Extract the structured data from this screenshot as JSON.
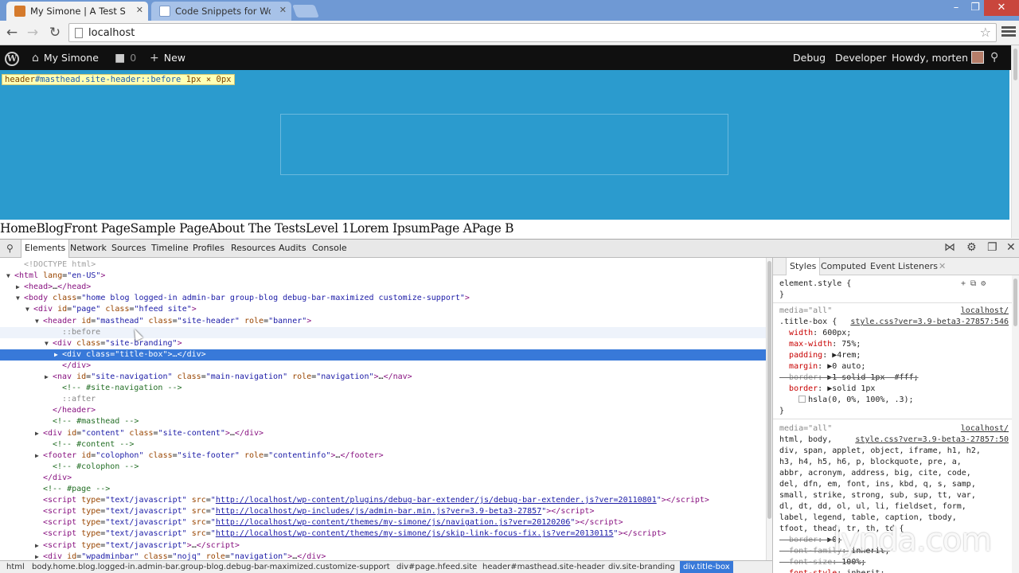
{
  "browser": {
    "tabs": [
      {
        "title": "My Simone | A Test Site fo",
        "active": true
      },
      {
        "title": "Code Snippets for WordPr",
        "active": false
      }
    ],
    "url": "localhost"
  },
  "admin_bar": {
    "site_name": "My Simone",
    "comments_count": "0",
    "new_label": "New",
    "debug_label": "Debug",
    "developer_label": "Developer",
    "howdy_label": "Howdy, morten"
  },
  "site": {
    "inspect_tooltip": {
      "tag": "header",
      "selector": "#masthead.site-header::before",
      "size": "1px × 0px"
    },
    "nav_items": [
      "Home",
      "Blog",
      "Front Page",
      "Sample Page",
      "About The Tests",
      "Level 1",
      "Lorem Ipsum",
      "Page A",
      "Page B"
    ]
  },
  "devtools": {
    "tabs": [
      "Elements",
      "Network",
      "Sources",
      "Timeline",
      "Profiles",
      "Resources",
      "Audits",
      "Console"
    ],
    "active_tab": "Elements",
    "dom_lines": [
      {
        "indent": 1,
        "tri": "",
        "cls": "dc",
        "text": "<!DOCTYPE html>"
      },
      {
        "indent": 0,
        "tri": "▼",
        "html": "<span class=\"tg\">&lt;html</span> <span class=\"an\">lang</span>=<span class=\"av\">\"en-US\"</span><span class=\"tg\">&gt;</span>"
      },
      {
        "indent": 1,
        "tri": "▶",
        "html": "<span class=\"tg\">&lt;head&gt;</span>…<span class=\"tg\">&lt;/head&gt;</span>"
      },
      {
        "indent": 1,
        "tri": "▼",
        "html": "<span class=\"tg\">&lt;body</span> <span class=\"an\">class</span>=<span class=\"av\">\"home blog logged-in admin-bar group-blog debug-bar-maximized customize-support\"</span><span class=\"tg\">&gt;</span>"
      },
      {
        "indent": 2,
        "tri": "▼",
        "html": "<span class=\"tg\">&lt;div</span> <span class=\"an\">id</span>=<span class=\"av\">\"page\"</span> <span class=\"an\">class</span>=<span class=\"av\">\"hfeed site\"</span><span class=\"tg\">&gt;</span>"
      },
      {
        "indent": 3,
        "tri": "▼",
        "html": "<span class=\"tg\">&lt;header</span> <span class=\"an\">id</span>=<span class=\"av\">\"masthead\"</span> <span class=\"an\">class</span>=<span class=\"av\">\"site-header\"</span> <span class=\"an\">role</span>=<span class=\"av\">\"banner\"</span><span class=\"tg\">&gt;</span>"
      },
      {
        "indent": 5,
        "tri": "",
        "hov": true,
        "html": "<span class=\"ps\">::before</span>"
      },
      {
        "indent": 4,
        "tri": "▼",
        "html": "<span class=\"tg\">&lt;div</span> <span class=\"an\">class</span>=<span class=\"av\">\"site-branding\"</span><span class=\"tg\">&gt;</span>"
      },
      {
        "indent": 5,
        "tri": "▶",
        "sel": true,
        "html": "<span class=\"tg\">&lt;div</span> <span class=\"an\">class</span>=<span class=\"av\">\"title-box\"</span><span class=\"tg\">&gt;</span>…<span class=\"tg\">&lt;/div&gt;</span>"
      },
      {
        "indent": 5,
        "tri": "",
        "html": "<span class=\"tg\">&lt;/div&gt;</span>"
      },
      {
        "indent": 4,
        "tri": "▶",
        "html": "<span class=\"tg\">&lt;nav</span> <span class=\"an\">id</span>=<span class=\"av\">\"site-navigation\"</span> <span class=\"an\">class</span>=<span class=\"av\">\"main-navigation\"</span> <span class=\"an\">role</span>=<span class=\"av\">\"navigation\"</span><span class=\"tg\">&gt;</span>…<span class=\"tg\">&lt;/nav&gt;</span>"
      },
      {
        "indent": 5,
        "tri": "",
        "html": "<span class=\"cm\">&lt;!-- #site-navigation --&gt;</span>"
      },
      {
        "indent": 5,
        "tri": "",
        "html": "<span class=\"ps\">::after</span>"
      },
      {
        "indent": 4,
        "tri": "",
        "html": "<span class=\"tg\">&lt;/header&gt;</span>"
      },
      {
        "indent": 4,
        "tri": "",
        "html": "<span class=\"cm\">&lt;!-- #masthead --&gt;</span>"
      },
      {
        "indent": 3,
        "tri": "▶",
        "html": "<span class=\"tg\">&lt;div</span> <span class=\"an\">id</span>=<span class=\"av\">\"content\"</span> <span class=\"an\">class</span>=<span class=\"av\">\"site-content\"</span><span class=\"tg\">&gt;</span>…<span class=\"tg\">&lt;/div&gt;</span>"
      },
      {
        "indent": 4,
        "tri": "",
        "html": "<span class=\"cm\">&lt;!-- #content --&gt;</span>"
      },
      {
        "indent": 3,
        "tri": "▶",
        "html": "<span class=\"tg\">&lt;footer</span> <span class=\"an\">id</span>=<span class=\"av\">\"colophon\"</span> <span class=\"an\">class</span>=<span class=\"av\">\"site-footer\"</span> <span class=\"an\">role</span>=<span class=\"av\">\"contentinfo\"</span><span class=\"tg\">&gt;</span>…<span class=\"tg\">&lt;/footer&gt;</span>"
      },
      {
        "indent": 4,
        "tri": "",
        "html": "<span class=\"cm\">&lt;!-- #colophon --&gt;</span>"
      },
      {
        "indent": 3,
        "tri": "",
        "html": "<span class=\"tg\">&lt;/div&gt;</span>"
      },
      {
        "indent": 3,
        "tri": "",
        "html": "<span class=\"cm\">&lt;!-- #page --&gt;</span>"
      },
      {
        "indent": 3,
        "tri": "",
        "html": "<span class=\"tg\">&lt;script</span> <span class=\"an\">type</span>=<span class=\"av\">\"text/javascript\"</span> <span class=\"an\">src</span>=<span class=\"av\">\"</span><span class=\"lk\">http://localhost/wp-content/plugins/debug-bar-extender/js/debug-bar-extender.js?ver=20110801</span><span class=\"av\">\"</span><span class=\"tg\">&gt;&lt;/script&gt;</span>"
      },
      {
        "indent": 3,
        "tri": "",
        "html": "<span class=\"tg\">&lt;script</span> <span class=\"an\">type</span>=<span class=\"av\">\"text/javascript\"</span> <span class=\"an\">src</span>=<span class=\"av\">\"</span><span class=\"lk\">http://localhost/wp-includes/js/admin-bar.min.js?ver=3.9-beta3-27857</span><span class=\"av\">\"</span><span class=\"tg\">&gt;&lt;/script&gt;</span>"
      },
      {
        "indent": 3,
        "tri": "",
        "html": "<span class=\"tg\">&lt;script</span> <span class=\"an\">type</span>=<span class=\"av\">\"text/javascript\"</span> <span class=\"an\">src</span>=<span class=\"av\">\"</span><span class=\"lk\">http://localhost/wp-content/themes/my-simone/js/navigation.js?ver=20120206</span><span class=\"av\">\"</span><span class=\"tg\">&gt;&lt;/script&gt;</span>"
      },
      {
        "indent": 3,
        "tri": "",
        "html": "<span class=\"tg\">&lt;script</span> <span class=\"an\">type</span>=<span class=\"av\">\"text/javascript\"</span> <span class=\"an\">src</span>=<span class=\"av\">\"</span><span class=\"lk\">http://localhost/wp-content/themes/my-simone/js/skip-link-focus-fix.js?ver=20130115</span><span class=\"av\">\"</span><span class=\"tg\">&gt;&lt;/script&gt;</span>"
      },
      {
        "indent": 3,
        "tri": "▶",
        "html": "<span class=\"tg\">&lt;script</span> <span class=\"an\">type</span>=<span class=\"av\">\"text/javascript\"</span><span class=\"tg\">&gt;</span>…<span class=\"tg\">&lt;/script&gt;</span>"
      },
      {
        "indent": 3,
        "tri": "▶",
        "html": "<span class=\"tg\">&lt;div</span> <span class=\"an\">id</span>=<span class=\"av\">\"wpadminbar\"</span> <span class=\"an\">class</span>=<span class=\"av\">\"nojq\"</span> <span class=\"an\">role</span>=<span class=\"av\">\"navigation\"</span><span class=\"tg\">&gt;</span>…<span class=\"tg\">&lt;/div&gt;</span>"
      }
    ],
    "breadcrumbs": [
      "html",
      "body.home.blog.logged-in.admin-bar.group-blog.debug-bar-maximized.customize-support",
      "div#page.hfeed.site",
      "header#masthead.site-header",
      "div.site-branding",
      "div.title-box"
    ],
    "styles": {
      "tabs": [
        "Styles",
        "Computed",
        "Event Listeners"
      ],
      "element_style": "element.style {",
      "rule1": {
        "media": "media=\"all\"",
        "source_host": "localhost/",
        "selector": ".title-box {",
        "source_file": "style.css?ver=3.9-beta3-27857:546",
        "props": [
          {
            "name": "width",
            "value": "600px;",
            "struck": false
          },
          {
            "name": "max-width",
            "value": "75%;",
            "struck": false
          },
          {
            "name": "padding",
            "value": "▶4rem;",
            "struck": false
          },
          {
            "name": "margin",
            "value": "▶0 auto;",
            "struck": false
          },
          {
            "name": "border",
            "value": "▶1 solid 1px  #fff;",
            "struck": true
          },
          {
            "name": "border",
            "value": "▶solid 1px",
            "struck": false
          }
        ],
        "border_color": "hsla(0, 0%, 100%, .3);"
      },
      "rule2": {
        "media": "media=\"all\"",
        "source_host": "localhost/",
        "selector_head": "html, body,",
        "source_file": "style.css?ver=3.9-beta3-27857:50",
        "selector_lines": [
          "div, span, applet, object, iframe, h1, h2,",
          "h3, h4, h5, h6, p, blockquote, pre, a,",
          "abbr, acronym, address, big, cite, code,",
          "del, dfn, em, font, ins, kbd, q, s, samp,",
          "small, strike, strong, sub, sup, tt, var,",
          "dl, dt, dd, ol, ul, li, fieldset, form,",
          "label, legend, table, caption, tbody,",
          "tfoot, thead, tr, th, td {"
        ],
        "props": [
          {
            "name": "border",
            "value": "▶0;",
            "struck": true
          },
          {
            "name": "font-family",
            "value": "inherit;",
            "struck": true
          },
          {
            "name": "font-size",
            "value": "100%;",
            "struck": true
          },
          {
            "name": "font-style",
            "value": "inherit;",
            "struck": false
          },
          {
            "name": "font-weight",
            "value": "inherit;",
            "struck": true
          }
        ]
      }
    }
  },
  "watermark": "lynda.com"
}
